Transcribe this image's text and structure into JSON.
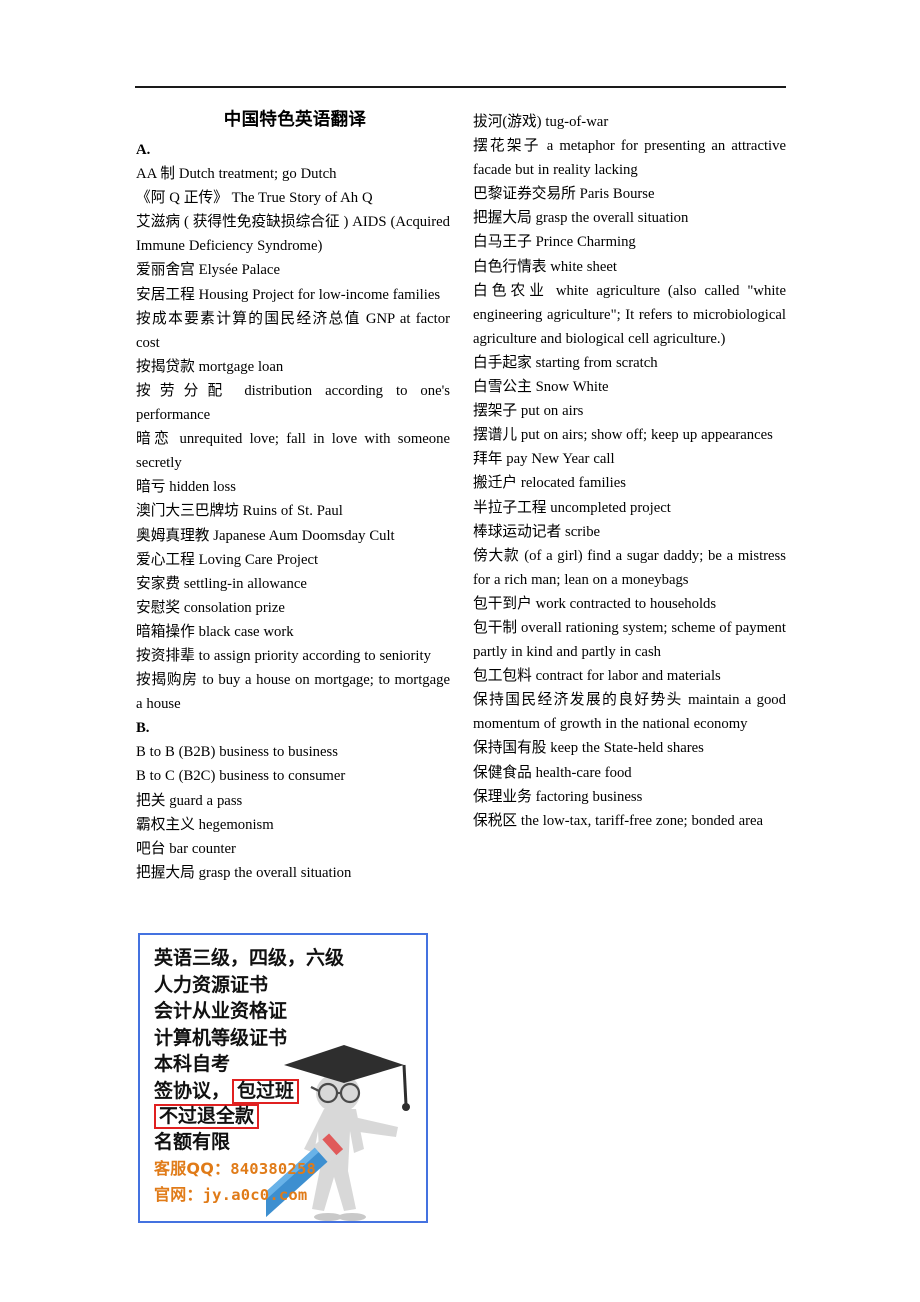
{
  "document": {
    "title": "中国特色英语翻译",
    "header_rule": true
  },
  "columns": {
    "left": [
      {
        "text": "A.",
        "bold": true
      },
      {
        "text": "AA 制  Dutch treatment; go Dutch",
        "bold": false
      },
      {
        "text": "《阿 Q 正传》  The True Story of Ah Q",
        "bold": false
      },
      {
        "text": "艾滋病 ( 获得性免疫缺损综合征 ) AIDS (Acquired Immune Deficiency Syndrome)",
        "bold": false
      },
      {
        "text": "爱丽舍宫  Elysée Palace",
        "bold": false
      },
      {
        "text": "安居工程  Housing Project for low-income families",
        "bold": false
      },
      {
        "text": "按成本要素计算的国民经济总值  GNP at factor cost",
        "bold": false
      },
      {
        "text": "按揭贷款  mortgage loan",
        "bold": false
      },
      {
        "text": "按劳分配  distribution according to one's performance",
        "bold": false
      },
      {
        "text": "暗恋  unrequited love; fall in love with someone secretly",
        "bold": false
      },
      {
        "text": "暗亏  hidden loss",
        "bold": false
      },
      {
        "text": "澳门大三巴牌坊  Ruins of St. Paul",
        "bold": false
      },
      {
        "text": "奥姆真理教  Japanese Aum Doomsday Cult",
        "bold": false
      },
      {
        "text": "爱心工程  Loving Care Project",
        "bold": false
      },
      {
        "text": "安家费  settling-in allowance",
        "bold": false
      },
      {
        "text": "安慰奖  consolation prize",
        "bold": false
      },
      {
        "text": "暗箱操作  black case work",
        "bold": false
      },
      {
        "text": "按资排辈  to assign priority according to seniority",
        "bold": false
      },
      {
        "text": "按揭购房  to buy a house on mortgage; to mortgage a house",
        "bold": false
      },
      {
        "text": "B.",
        "bold": true
      },
      {
        "text": "B to B (B2B) business to business",
        "bold": false
      },
      {
        "text": "B to C (B2C) business to consumer",
        "bold": false
      },
      {
        "text": "把关  guard a pass",
        "bold": false
      },
      {
        "text": "霸权主义  hegemonism",
        "bold": false
      },
      {
        "text": "吧台  bar counter",
        "bold": false
      },
      {
        "text": "把握大局  grasp the overall situation",
        "bold": false
      }
    ],
    "right": [
      {
        "text": "拔河(游戏) tug-of-war",
        "bold": false
      },
      {
        "text": "摆花架子  a metaphor for presenting an attractive facade but in reality lacking",
        "bold": false
      },
      {
        "text": "巴黎证券交易所  Paris Bourse",
        "bold": false
      },
      {
        "text": "把握大局  grasp the overall situation",
        "bold": false
      },
      {
        "text": "白马王子  Prince Charming",
        "bold": false
      },
      {
        "text": "白色行情表  white sheet",
        "bold": false
      },
      {
        "text": "白色农业  white agriculture (also called \"white engineering agriculture\"; It refers to microbiological agriculture and biological cell agriculture.)",
        "bold": false
      },
      {
        "text": "白手起家  starting from scratch",
        "bold": false
      },
      {
        "text": "白雪公主  Snow White",
        "bold": false
      },
      {
        "text": "摆架子  put on airs",
        "bold": false
      },
      {
        "text": "摆谱儿  put on airs; show off; keep up appearances",
        "bold": false
      },
      {
        "text": "拜年  pay New Year call",
        "bold": false
      },
      {
        "text": "搬迁户  relocated families",
        "bold": false
      },
      {
        "text": "半拉子工程  uncompleted project",
        "bold": false
      },
      {
        "text": "棒球运动记者  scribe",
        "bold": false
      },
      {
        "text": "傍大款  (of a girl) find a sugar daddy; be a mistress for a rich man; lean on a moneybags",
        "bold": false
      },
      {
        "text": "包干到户  work contracted to households",
        "bold": false
      },
      {
        "text": "包干制  overall rationing system; scheme of payment partly in kind and partly in cash",
        "bold": false
      },
      {
        "text": "包工包料  contract for labor and materials",
        "bold": false
      },
      {
        "text": "保持国民经济发展的良好势头  maintain a good momentum of growth in the national economy",
        "bold": false
      },
      {
        "text": "保持国有股  keep the State-held shares",
        "bold": false
      },
      {
        "text": "保健食品  health-care food",
        "bold": false
      },
      {
        "text": "保理业务  factoring business",
        "bold": false
      },
      {
        "text": "保税区  the low-tax, tariff-free zone; bonded area",
        "bold": false
      }
    ]
  },
  "advertisement": {
    "border_color": "#4472e0",
    "highlight_color": "#e02020",
    "contact_color": "#e07b18",
    "lines": [
      "英语三级，四级，六级",
      "人力资源证书",
      "会计从业资格证",
      "计算机等级证书",
      "本科自考"
    ],
    "line_agreement_prefix": "签协议，",
    "line_agreement_boxed": "包过班",
    "line_refund_boxed": "不过退全款",
    "line_limited": "名额有限",
    "qq_label": "客服QQ：",
    "qq_value": "840380258",
    "site_label": "官网：",
    "site_value": "jy.a0c0.com"
  }
}
